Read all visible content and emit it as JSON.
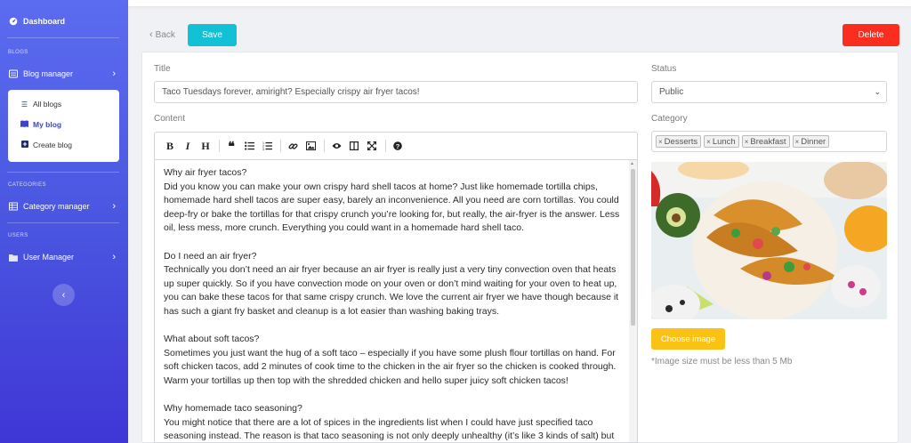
{
  "sidebar": {
    "dashboard": "Dashboard",
    "sections": {
      "blogs": "BLOGS",
      "categories": "CATEGORIES",
      "users": "USERS"
    },
    "blog_manager": "Blog manager",
    "submenu": [
      {
        "label": "All blogs"
      },
      {
        "label": "My blog"
      },
      {
        "label": "Create blog"
      }
    ],
    "category_manager": "Category manager",
    "user_manager": "User Manager",
    "collapse_icon": "chevron-left-icon"
  },
  "actions": {
    "back": "Back",
    "save": "Save",
    "delete": "Delete"
  },
  "colors": {
    "save": "#13c1d6",
    "delete": "#fb2d1e",
    "choose_image": "#fbc216",
    "sidebar_top": "#5b6cf0",
    "sidebar_bottom": "#4036d6"
  },
  "form": {
    "title_label": "Title",
    "title_value": "Taco Tuesdays forever, amiright? Especially crispy air fryer tacos!",
    "content_label": "Content",
    "status_label": "Status",
    "status_value": "Public",
    "category_label": "Category",
    "categories": [
      "Desserts",
      "Lunch",
      "Breakfast",
      "Dinner"
    ],
    "choose_image": "Choose image",
    "image_hint": "*Image size must be less than 5 Mb"
  },
  "toolbar_icons": [
    "bold-icon",
    "italic-icon",
    "heading-icon",
    "quote-icon",
    "unordered-list-icon",
    "ordered-list-icon",
    "link-icon",
    "image-icon",
    "preview-icon",
    "side-by-side-icon",
    "fullscreen-icon",
    "help-icon"
  ],
  "content": {
    "paragraphs": [
      "Why air fryer tacos?",
      "Did you know you can make your own crispy hard shell tacos at home? Just like homemade tortilla chips, homemade hard shell tacos are super easy, barely an inconvenience. All you need are corn tortillas. You could deep-fry or bake the tortillas for that crispy crunch you’re looking for, but really, the air-fryer is the answer. Less oil, less mess, more crunch. Everything you could want in a homemade hard shell taco.",
      "",
      "Do I need an air fryer?",
      "Technically you don’t need an air fryer because an air fryer is really just a very tiny convection oven that heats up super quickly. So if you have convection mode on your oven or don’t mind waiting for your oven to heat up, you can bake these tacos for that same crispy crunch. We love the current air fryer we have though because it has such a giant fry basket and cleanup is a lot easier than washing baking trays.",
      "",
      "What about soft tacos?",
      "Sometimes you just want the hug of a soft taco – especially if you have some plush flour tortillas on hand. For soft chicken tacos, add 2 minutes of cook time to the chicken in the air fryer so the chicken is cooked through. Warm your tortillas up then top with the shredded chicken and hello super juicy soft chicken tacos!",
      "",
      "Why homemade taco seasoning?",
      "You might notice that there are a lot of spices in the ingredients list when I could have just specified taco seasoning instead. The reason is that taco seasoning is not only deeply unhealthy (it’s like 3 kinds of salt) but"
    ]
  }
}
